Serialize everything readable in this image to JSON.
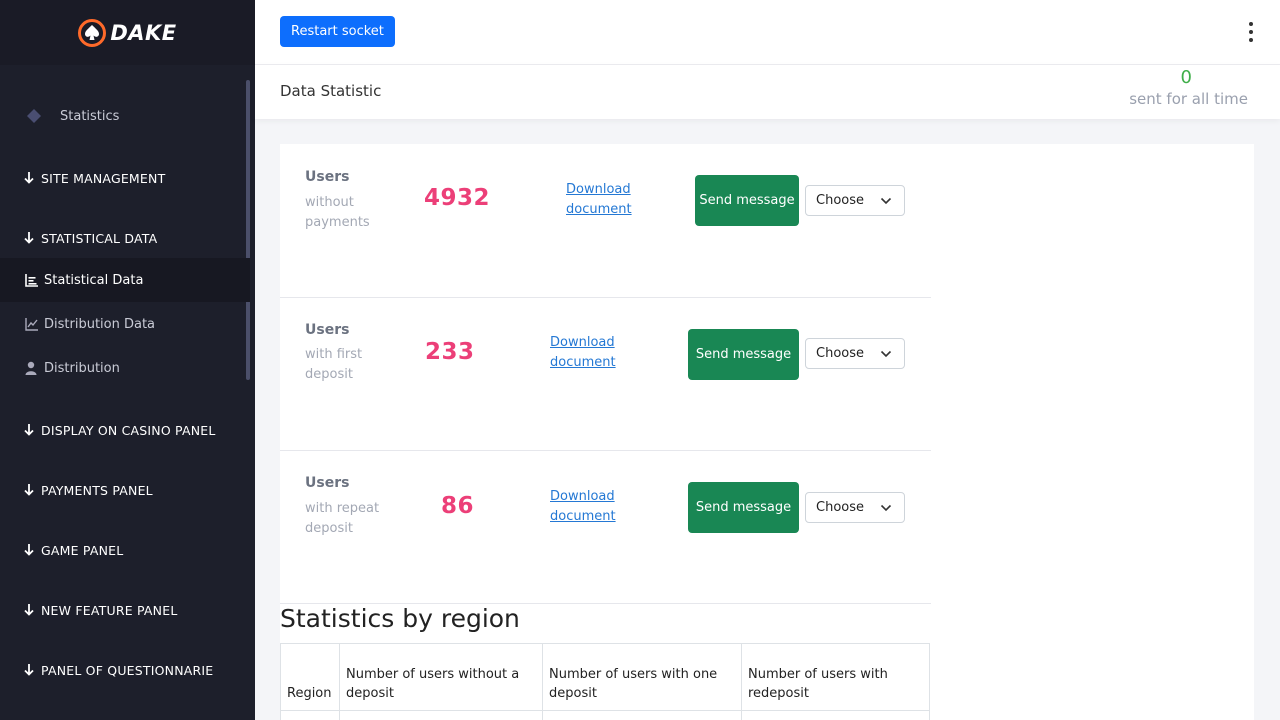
{
  "brand": {
    "name": "DAKE",
    "accent": "#ff6a2a"
  },
  "sidebar": {
    "top_item": {
      "label": "Statistics",
      "icon": "diamond-icon"
    },
    "sections": [
      {
        "label": "SITE MANAGEMENT"
      },
      {
        "label": "STATISTICAL DATA"
      },
      {
        "label": "DISPLAY ON CASINO PANEL"
      },
      {
        "label": "PAYMENTS PANEL"
      },
      {
        "label": "GAME PANEL"
      },
      {
        "label": "NEW FEATURE PANEL"
      },
      {
        "label": "PANEL OF QUESTIONNARIE"
      }
    ],
    "sub_items": [
      {
        "label": "Statistical Data",
        "icon": "bar-chart-icon",
        "active": true
      },
      {
        "label": "Distribution Data",
        "icon": "line-chart-icon"
      },
      {
        "label": "Distribution",
        "icon": "user-icon"
      }
    ]
  },
  "topbar": {
    "restart_label": "Restart socket",
    "menu_icon": "kebab-menu-icon"
  },
  "subheader": {
    "title": "Data Statistic",
    "sent_count": "0",
    "sent_label": "sent for all time"
  },
  "stats": [
    {
      "title": "Users",
      "subtitle": "without payments",
      "value": "4932",
      "download": "Download document",
      "send": "Send message",
      "select": "Choose"
    },
    {
      "title": "Users",
      "subtitle": "with first deposit",
      "value": "233",
      "download": "Download document",
      "send": "Send message",
      "select": "Choose"
    },
    {
      "title": "Users",
      "subtitle": "with repeat deposit",
      "value": "86",
      "download": "Download document",
      "send": "Send message",
      "select": "Choose"
    }
  ],
  "region": {
    "title": "Statistics by region",
    "columns": [
      "Region",
      "Number of users without a deposit",
      "Number of users with one deposit",
      "Number of users with redeposit"
    ]
  }
}
